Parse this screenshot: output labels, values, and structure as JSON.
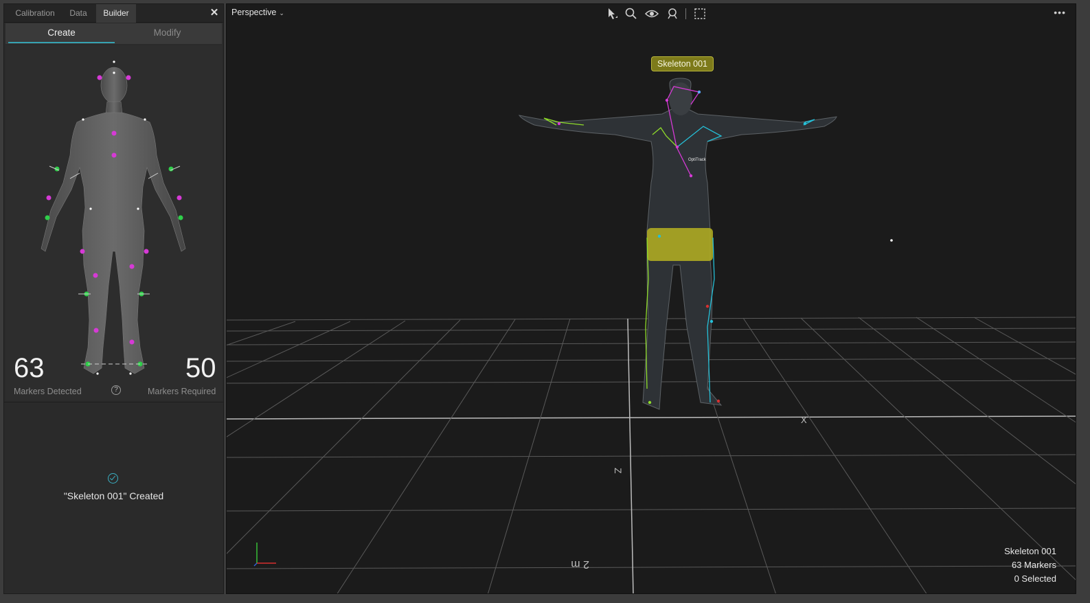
{
  "panel": {
    "tabs": [
      {
        "label": "Calibration",
        "active": false
      },
      {
        "label": "Data",
        "active": false
      },
      {
        "label": "Builder",
        "active": true
      }
    ],
    "close_icon": "close-icon",
    "modes": [
      {
        "label": "Create",
        "active": true
      },
      {
        "label": "Modify",
        "active": false
      }
    ],
    "markers_detected": {
      "value": "63",
      "label": "Markers Detected"
    },
    "markers_required": {
      "value": "50",
      "label": "Markers Required"
    },
    "help_icon": "?",
    "status_message": "\"Skeleton 001\" Created",
    "status_icon": "check-circle-icon"
  },
  "viewport": {
    "view_mode": "Perspective",
    "tools": [
      "select-icon",
      "zoom-icon",
      "visibility-icon",
      "lock-view-icon",
      "selection-box-icon"
    ],
    "skeleton_label": "Skeleton 001",
    "grid_labels": [
      "2 m",
      "Z",
      "X"
    ],
    "info": {
      "name": "Skeleton 001",
      "markers": "63 Markers",
      "selected": "0 Selected"
    }
  },
  "colors": {
    "accent": "#36a3b2",
    "marker_magenta": "#d63ad6",
    "marker_green": "#2fcf4a",
    "bone_cyan": "#25c0d8",
    "bone_lime": "#8fdc2a",
    "skeleton_tag_bg": "#7d7a1a"
  }
}
